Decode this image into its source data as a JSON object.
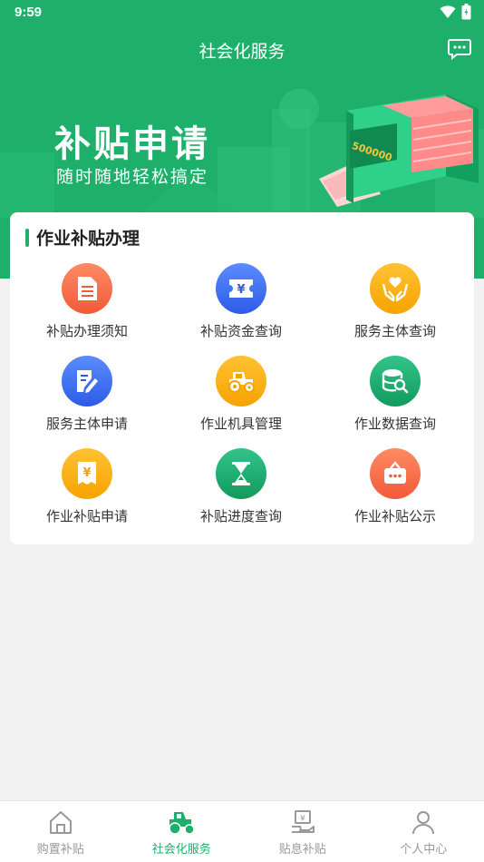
{
  "status_bar": {
    "time": "9:59"
  },
  "header": {
    "title": "社会化服务",
    "message_icon": "message-icon"
  },
  "banner": {
    "title": "补贴申请",
    "subtitle": "随时随地轻松搞定",
    "machine_text": "500000"
  },
  "section": {
    "title": "作业补贴办理",
    "items": [
      {
        "label": "补贴办理须知",
        "icon": "document-icon",
        "color": "#f15a37"
      },
      {
        "label": "补贴资金查询",
        "icon": "yuan-ticket-icon",
        "color": "#2e5be6"
      },
      {
        "label": "服务主体查询",
        "icon": "heart-hands-icon",
        "color": "#f6a300"
      },
      {
        "label": "服务主体申请",
        "icon": "edit-document-icon",
        "color": "#2e5be6"
      },
      {
        "label": "作业机具管理",
        "icon": "tractor-icon",
        "color": "#f6a300"
      },
      {
        "label": "作业数据查询",
        "icon": "database-search-icon",
        "color": "#119a5c"
      },
      {
        "label": "作业补贴申请",
        "icon": "yuan-receipt-icon",
        "color": "#f6a300"
      },
      {
        "label": "补贴进度查询",
        "icon": "hourglass-icon",
        "color": "#119a5c"
      },
      {
        "label": "作业补贴公示",
        "icon": "bulletin-board-icon",
        "color": "#f15a37"
      }
    ]
  },
  "tabbar": {
    "tabs": [
      {
        "label": "购置补贴",
        "icon": "home-icon",
        "active": false
      },
      {
        "label": "社会化服务",
        "icon": "tractor-tab-icon",
        "active": true
      },
      {
        "label": "贴息补贴",
        "icon": "yuan-hand-icon",
        "active": false
      },
      {
        "label": "个人中心",
        "icon": "person-icon",
        "active": false
      }
    ],
    "active_color": "#1eb06a",
    "inactive_color": "#999999"
  },
  "colors": {
    "primary": "#1eb06a",
    "background": "#f2f2f2"
  }
}
